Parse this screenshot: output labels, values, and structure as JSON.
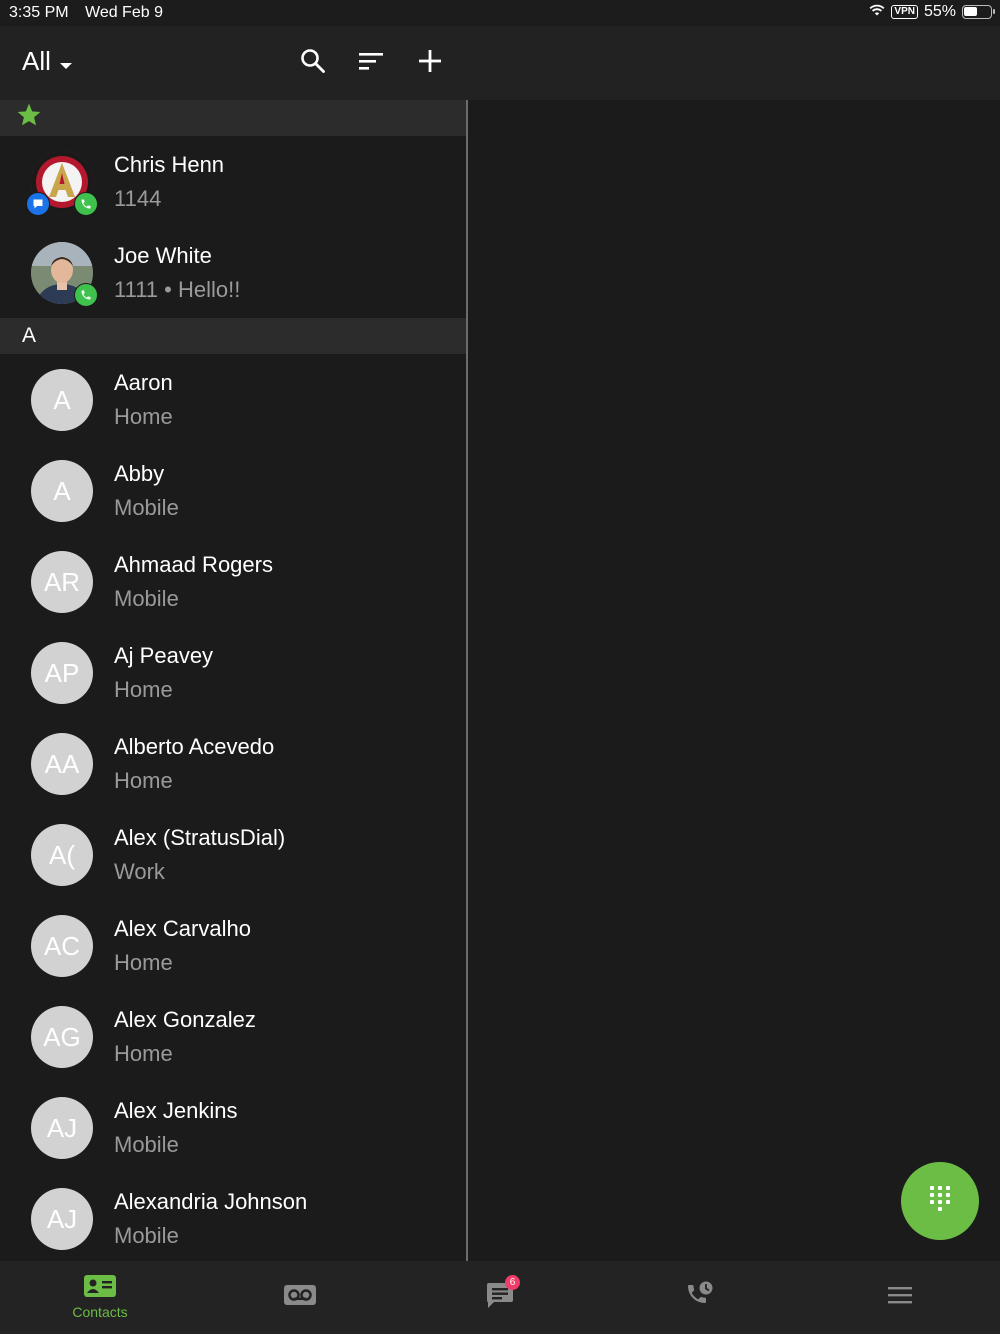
{
  "status_bar": {
    "time": "3:35 PM",
    "date": "Wed Feb 9",
    "vpn": "VPN",
    "battery": "55%",
    "battery_level": 0.55
  },
  "header": {
    "filter_label": "All"
  },
  "favorites": [
    {
      "name": "Chris Henn",
      "subtitle": "1144"
    },
    {
      "name": "Joe White",
      "subtitle": "1111 • Hello!!"
    }
  ],
  "section_letter": "A",
  "contacts": [
    {
      "initials": "A",
      "name": "Aaron",
      "subtitle": "Home"
    },
    {
      "initials": "A",
      "name": "Abby",
      "subtitle": "Mobile"
    },
    {
      "initials": "AR",
      "name": "Ahmaad Rogers",
      "subtitle": "Mobile"
    },
    {
      "initials": "AP",
      "name": "Aj Peavey",
      "subtitle": "Home"
    },
    {
      "initials": "AA",
      "name": "Alberto Acevedo",
      "subtitle": "Home"
    },
    {
      "initials": "A(",
      "name": "Alex (StratusDial)",
      "subtitle": "Work"
    },
    {
      "initials": "AC",
      "name": "Alex Carvalho",
      "subtitle": "Home"
    },
    {
      "initials": "AG",
      "name": "Alex Gonzalez",
      "subtitle": "Home"
    },
    {
      "initials": "AJ",
      "name": "Alex Jenkins",
      "subtitle": "Mobile"
    },
    {
      "initials": "AJ",
      "name": "Alexandria Johnson",
      "subtitle": "Mobile"
    }
  ],
  "tabs": {
    "contacts_label": "Contacts",
    "messages_badge": "6"
  },
  "colors": {
    "accent": "#6cbd45",
    "presence_green": "#3fc24d",
    "presence_blue": "#1a73e8",
    "badge": "#ef3d6a"
  }
}
